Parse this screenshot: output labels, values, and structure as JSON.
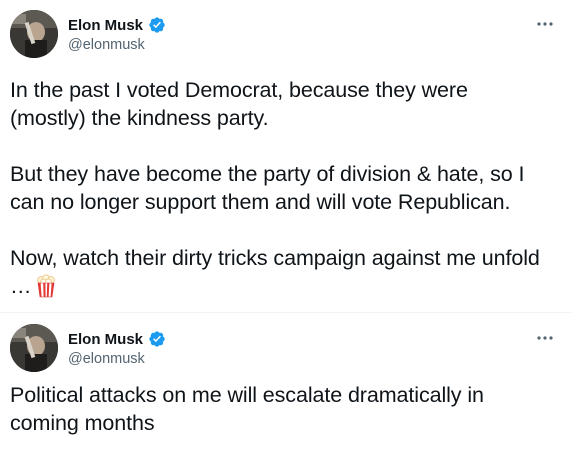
{
  "tweets": [
    {
      "author": {
        "display_name": "Elon Musk",
        "handle": "@elonmusk",
        "verified": true
      },
      "paragraphs": [
        "In the past I voted Democrat, because they were (mostly) the kindness party.",
        "But they have become the party of division & hate, so I can no longer support them and will vote Republican.",
        "Now, watch their dirty tricks campaign against me unfold …"
      ],
      "trailing_emoji": "popcorn-icon"
    },
    {
      "author": {
        "display_name": "Elon Musk",
        "handle": "@elonmusk",
        "verified": true
      },
      "paragraphs": [
        "Political attacks on me will escalate dramatically in coming months"
      ]
    }
  ],
  "colors": {
    "text_primary": "#0f1419",
    "text_secondary": "#536471",
    "verified_blue": "#1d9bf0",
    "divider": "#eff3f4",
    "background": "#ffffff"
  },
  "icons": {
    "verified": "verified-badge-icon",
    "more": "more-options-icon",
    "popcorn": "popcorn-icon"
  }
}
